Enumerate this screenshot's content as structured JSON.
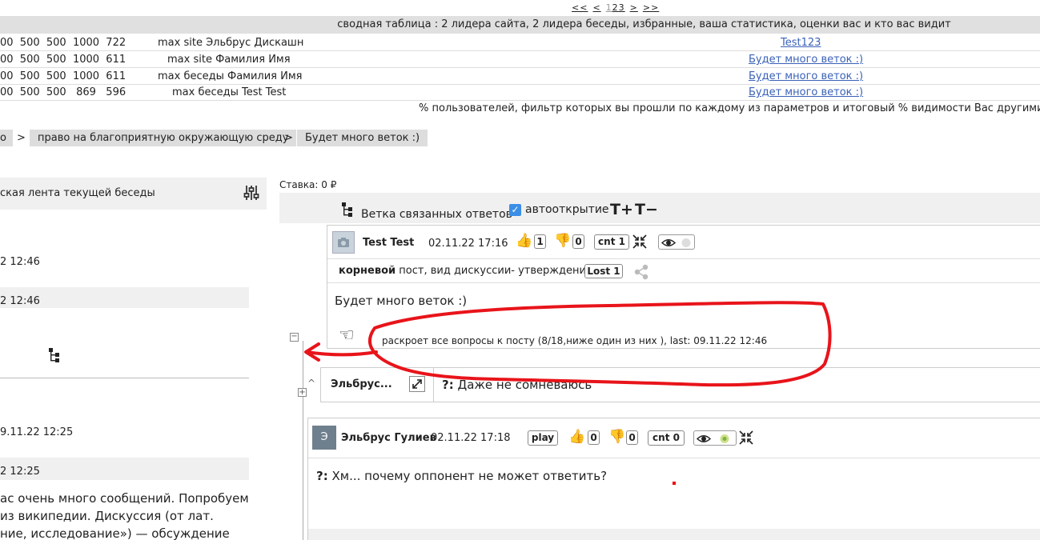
{
  "pager": {
    "first": "<<",
    "prev": "<",
    "pages": [
      "1",
      "2",
      "3"
    ],
    "next": ">",
    "last": ">>"
  },
  "summary": {
    "header": "сводная таблица : 2 лидера сайта, 2 лидера беседы, избранные, ваша статистика, оценки вас и кто вас видит",
    "rows": [
      {
        "nums": "00  500  500  1000  722",
        "label": "max site Эльбрус Дискашн",
        "link": "Test123"
      },
      {
        "nums": "00  500  500  1000  611",
        "label": "max site Фамилия Имя",
        "link": "Будет много веток :)"
      },
      {
        "nums": "00  500  500  1000  611",
        "label": "max беседы Фамилия Имя",
        "link": "Будет много веток :)"
      },
      {
        "nums": "00  500  500   869   596",
        "label": "max беседы Test Test",
        "link": "Будет много веток :)"
      }
    ],
    "percent_note": "% пользователей, фильтр которых вы прошли по каждому из параметров и итоговый % видимости Вас другими участни"
  },
  "breadcrumb": {
    "items": [
      "о",
      "право на благоприятную окружающую среду",
      "Будет много веток :)"
    ],
    "separator": ">"
  },
  "left": {
    "feed_title": "ская лента текущей беседы",
    "times": [
      "2 12:46",
      "2 12:46",
      "9.11.22 12:25",
      "2 12:25"
    ],
    "paragraph": [
      "ас очень много сообщений. Попробуем",
      "из википедии. Дискуссия (от лат.",
      "ние, исследование») — обсуждение"
    ]
  },
  "stake": "Ставка: 0 ₽",
  "branch": {
    "title": "Ветка связанных ответов",
    "autoopen_label": "автооткрытие",
    "autoopen_checked": true,
    "font_plus": "T+",
    "font_minus": "T−"
  },
  "root_post": {
    "author": "Test Test",
    "date": "02.11.22 17:16",
    "likes": "1",
    "dislikes": "0",
    "cnt": "cnt 1",
    "sub_bold": "корневой",
    "sub_text": " пост, вид дискуссии- утверждение",
    "lost": "Lost 1",
    "body": "Будет много веток :)",
    "reveal_prefix": ":",
    "reveal": "раскроет все вопросы к посту (8/18,ниже один из них ), last: 09.11.22 12:46"
  },
  "question": {
    "author": "Эльбрус...",
    "prefix": "?:",
    "text": " Даже не сомневаюсь"
  },
  "reply": {
    "avatar_letter": "Э",
    "author": "Эльбрус Гулиев",
    "date": "02.11.22 17:18",
    "play": "play",
    "likes": "0",
    "dislikes": "0",
    "cnt": "cnt 0",
    "prefix": "?:",
    "body": " Хм... почему оппонент не может ответить?"
  },
  "colors": {
    "annotation": "#e8141a",
    "link": "#3a62b8",
    "checkbox": "#3a8ee6",
    "panel_grey": "#f0f0f0"
  }
}
